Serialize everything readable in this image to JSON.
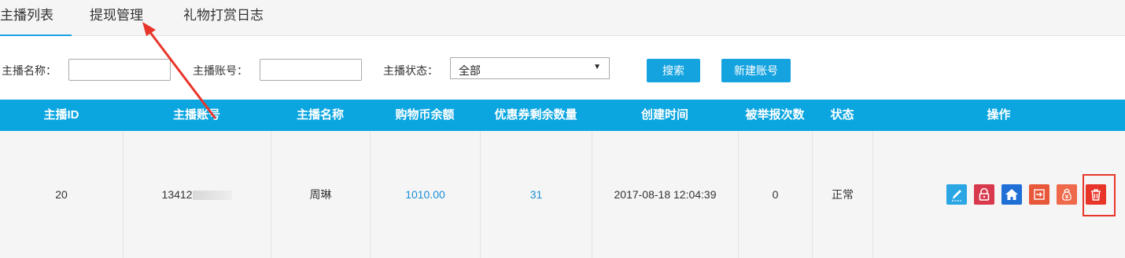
{
  "tabs": [
    {
      "label": "主播列表",
      "active": true
    },
    {
      "label": "提现管理",
      "active": false
    },
    {
      "label": "礼物打赏日志",
      "active": false
    }
  ],
  "filters": {
    "name_label": "主播名称：",
    "name_value": "",
    "account_label": "主播账号：",
    "account_value": "",
    "status_label": "主播状态：",
    "status_selected": "全部",
    "search_button": "搜索",
    "new_account_button": "新建账号"
  },
  "table": {
    "columns": [
      "主播ID",
      "主播账号",
      "主播名称",
      "购物币余额",
      "优惠券剩余数量",
      "创建时间",
      "被举报次数",
      "状态",
      "操作"
    ],
    "rows": [
      {
        "id": "20",
        "account_visible": "13412",
        "name": "周琳",
        "balance": "1010.00",
        "coupons": "31",
        "created": "2017-08-18 12:04:39",
        "reports": "0",
        "status": "正常"
      }
    ]
  },
  "actions": [
    {
      "icon": "edit-icon",
      "color": "#2aa6e4"
    },
    {
      "icon": "lock-icon",
      "color": "#d9394d"
    },
    {
      "icon": "home-icon",
      "color": "#1f6fd6"
    },
    {
      "icon": "login-icon",
      "color": "#e8573a"
    },
    {
      "icon": "money-bag-icon",
      "color": "#ef6a4a"
    },
    {
      "icon": "trash-icon",
      "color": "#e8352a"
    }
  ],
  "colors": {
    "header_bg": "#0ba6e0",
    "button_bg": "#14a3df",
    "link": "#1a8fd4",
    "annotation": "#e8352a"
  }
}
